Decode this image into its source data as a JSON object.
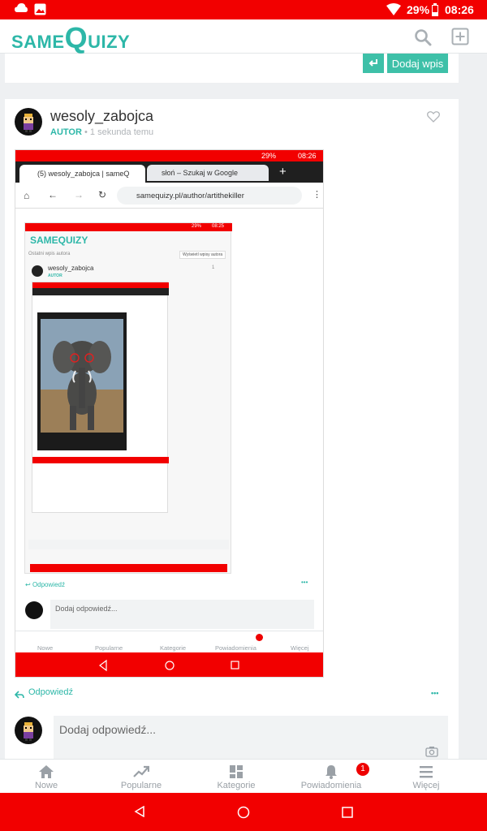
{
  "status_bar": {
    "battery": "29%",
    "time": "08:26"
  },
  "app": {
    "logo_same": "SAME",
    "logo_q": "Q",
    "logo_uizy": "UIZY"
  },
  "top_card": {
    "add_post": "Dodaj wpis"
  },
  "post": {
    "username": "wesoly_zabojca",
    "role": "AUTOR",
    "sep": "•",
    "time": "1 sekunda temu",
    "reply": "Odpowiedź",
    "more": "•••",
    "reply_placeholder": "Dodaj odpowiedź..."
  },
  "screenshot": {
    "status_battery": "29%",
    "status_time": "08:26",
    "tab1": "(5) wesoly_zabojca | sameQ",
    "tab2": "słoń – Szukaj w Google",
    "url": "samequizy.pl/author/artithekiller",
    "reply": "Odpowiedź",
    "reply_placeholder": "Dodaj odpowiedź...",
    "nested": {
      "status_battery": "29%",
      "status_time": "08:25",
      "last_post": "Ostatni wpis autora",
      "show_posts": "Wyświetl wpisy autora",
      "username": "wesoly_zabojca",
      "role": "AUTOR",
      "time": "1 sekunda temu",
      "likes": "1"
    },
    "nav": [
      "Nowe",
      "Popularne",
      "Kategorie",
      "Powiadomienia",
      "Więcej"
    ]
  },
  "bottom_nav": {
    "items": [
      "Nowe",
      "Popularne",
      "Kategorie",
      "Powiadomienia",
      "Więcej"
    ],
    "notif_count": "1"
  },
  "colors": {
    "red": "#f20000",
    "teal": "#2db7a8",
    "button": "#3ec0a8"
  }
}
